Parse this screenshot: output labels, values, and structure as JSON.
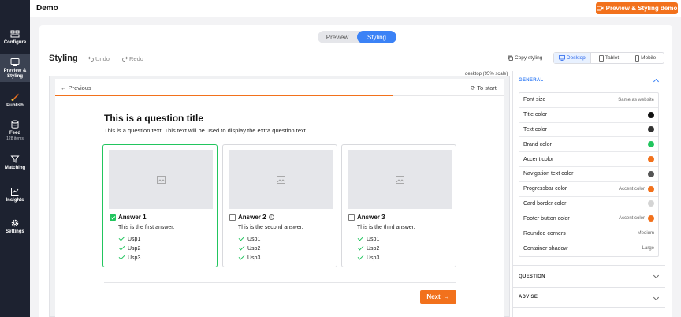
{
  "app": {
    "title": "Demo",
    "demo_button": "Preview & Styling demo"
  },
  "sidebar": {
    "items": [
      {
        "label": "Configure"
      },
      {
        "label": "Preview & Styling"
      },
      {
        "label": "Publish"
      },
      {
        "label": "Feed",
        "sub": "128 items"
      },
      {
        "label": "Matching"
      },
      {
        "label": "Insights"
      },
      {
        "label": "Settings"
      }
    ]
  },
  "mode_toggle": {
    "preview": "Preview",
    "styling": "Styling",
    "active": "Styling"
  },
  "toolbar": {
    "title": "Styling",
    "undo": "Undo",
    "redo": "Redo",
    "copy_styling": "Copy styling",
    "devices": [
      "Desktop",
      "Tablet",
      "Mobile"
    ],
    "active_device": "Desktop"
  },
  "preview": {
    "scale_label": "desktop (95% scale)",
    "previous": "Previous",
    "to_start": "To start",
    "progress": 0.75,
    "question_title": "This is a question title",
    "question_text": "This is a question text. This text will be used to display the extra question text.",
    "answers": [
      {
        "title": "Answer 1",
        "description": "This is the first answer.",
        "usps": [
          "Usp1",
          "Usp2",
          "Usp3"
        ],
        "selected": true
      },
      {
        "title": "Answer 2",
        "description": "This is the second answer.",
        "usps": [
          "Usp1",
          "Usp2",
          "Usp3"
        ],
        "selected": false,
        "info": true
      },
      {
        "title": "Answer 3",
        "description": "This is the third answer.",
        "usps": [
          "Usp1",
          "Usp2",
          "Usp3"
        ],
        "selected": false
      }
    ],
    "next": "Next"
  },
  "panel": {
    "general": "GENERAL",
    "question": "QUESTION",
    "advise": "ADVISE",
    "settings": [
      {
        "label": "Font size",
        "value": "Same as website",
        "color": null
      },
      {
        "label": "Title color",
        "value": "",
        "color": "#111111"
      },
      {
        "label": "Text color",
        "value": "",
        "color": "#333333"
      },
      {
        "label": "Brand color",
        "value": "",
        "color": "#22c55e"
      },
      {
        "label": "Accent color",
        "value": "",
        "color": "#f2711c"
      },
      {
        "label": "Navigation text color",
        "value": "",
        "color": "#555555"
      },
      {
        "label": "Progressbar color",
        "value": "Accent color",
        "color": "#f2711c"
      },
      {
        "label": "Card border color",
        "value": "",
        "color": "#d4d4d4"
      },
      {
        "label": "Footer button color",
        "value": "Accent color",
        "color": "#f2711c"
      },
      {
        "label": "Rounded corners",
        "value": "Medium",
        "color": null
      },
      {
        "label": "Container shadow",
        "value": "Large",
        "color": null
      }
    ]
  },
  "colors": {
    "accent": "#f2711c",
    "brand": "#22c55e",
    "primary_blue": "#3b82f6",
    "sidebar": "#1d2230"
  }
}
